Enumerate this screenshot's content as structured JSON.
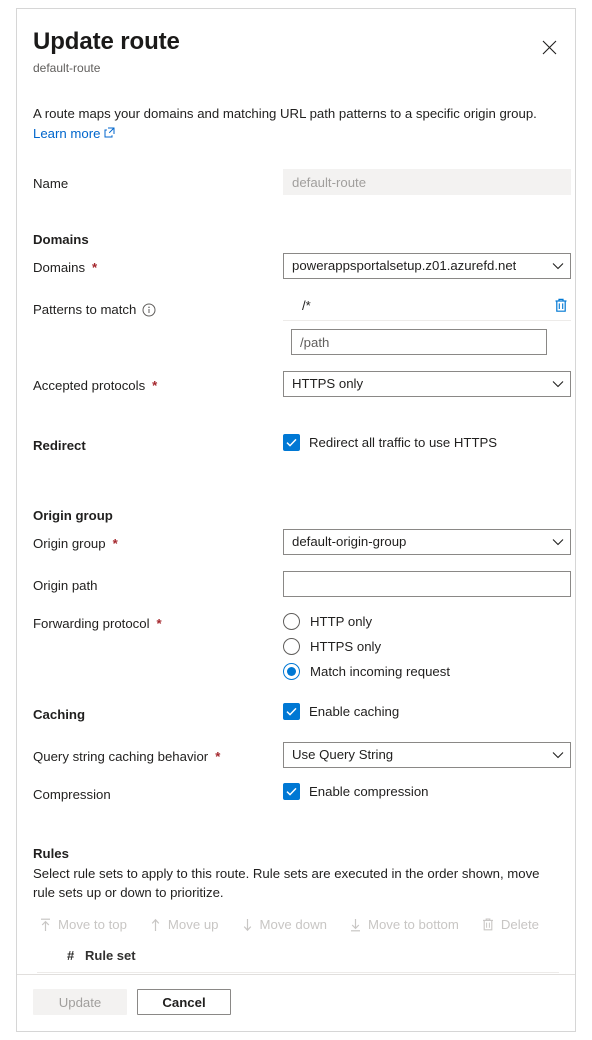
{
  "dialog": {
    "title": "Update route",
    "subtitle": "default-route",
    "close_label": "Close",
    "description": "A route maps your domains and matching URL path patterns to a specific origin group.",
    "learn_more": "Learn more"
  },
  "name_field": {
    "label": "Name",
    "value": "default-route"
  },
  "domains": {
    "section_title": "Domains",
    "domains_label": "Domains",
    "domains_value": "powerappsportalsetup.z01.azurefd.net",
    "patterns_label": "Patterns to match",
    "pattern_value": "/*",
    "pattern_placeholder": "/path",
    "delete_label": "Delete pattern",
    "protocols_label": "Accepted protocols",
    "protocols_value": "HTTPS only"
  },
  "redirect": {
    "label": "Redirect",
    "checkbox_label": "Redirect all traffic to use HTTPS",
    "checked": true
  },
  "origin_group": {
    "section_title": "Origin group",
    "group_label": "Origin group",
    "group_value": "default-origin-group",
    "path_label": "Origin path",
    "path_value": "",
    "forwarding_label": "Forwarding protocol",
    "forwarding_options": [
      {
        "label": "HTTP only",
        "selected": false
      },
      {
        "label": "HTTPS only",
        "selected": false
      },
      {
        "label": "Match incoming request",
        "selected": true
      }
    ]
  },
  "caching": {
    "label": "Caching",
    "enable_label": "Enable caching",
    "enable_checked": true,
    "query_label": "Query string caching behavior",
    "query_value": "Use Query String",
    "compression_label": "Compression",
    "compression_checkbox_label": "Enable compression",
    "compression_checked": true
  },
  "rules": {
    "title": "Rules",
    "description": "Select rule sets to apply to this route. Rule sets are executed in the order shown, move rule sets up or down to prioritize.",
    "toolbar": [
      {
        "label": "Move to top",
        "icon": "arrow-up-to-line-icon",
        "disabled": true
      },
      {
        "label": "Move up",
        "icon": "arrow-up-icon",
        "disabled": true
      },
      {
        "label": "Move down",
        "icon": "arrow-down-icon",
        "disabled": true
      },
      {
        "label": "Move to bottom",
        "icon": "arrow-down-to-line-icon",
        "disabled": true
      },
      {
        "label": "Delete",
        "icon": "trash-icon",
        "disabled": true
      }
    ],
    "columns": [
      "#",
      "Rule set"
    ],
    "rows": []
  },
  "footer": {
    "update_label": "Update",
    "update_disabled": true,
    "cancel_label": "Cancel"
  },
  "colors": {
    "accent": "#0078d4",
    "required": "#a4262c",
    "link": "#0066cc",
    "disabled_text": "#a19f9d",
    "disabled_bg": "#f3f2f1"
  }
}
